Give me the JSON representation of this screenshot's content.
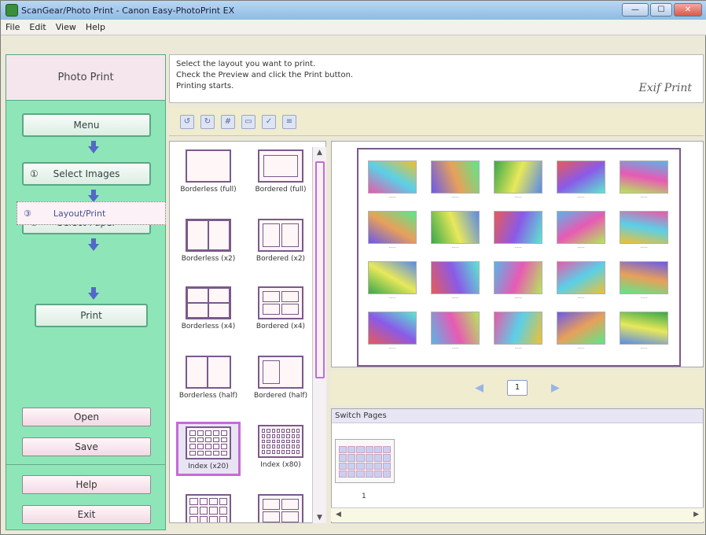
{
  "window": {
    "title": "ScanGear/Photo Print - Canon Easy-PhotoPrint EX",
    "buttons": {
      "minimize": "—",
      "maximize": "☐",
      "close": "✕"
    }
  },
  "menu": {
    "items": [
      "File",
      "Edit",
      "View",
      "Help"
    ]
  },
  "sidebar": {
    "title": "Photo Print",
    "menu_button": "Menu",
    "step1": {
      "num": "①",
      "label": "Select Images"
    },
    "step2": {
      "num": "②",
      "label": "Select Paper"
    },
    "step3": {
      "num": "③",
      "label": "Layout/Print"
    },
    "print_button": "Print",
    "open_button": "Open",
    "save_button": "Save",
    "help_button": "Help",
    "exit_button": "Exit"
  },
  "guide": {
    "line1": "Select the layout you want to print.",
    "line2": "Check the Preview and click the Print button.",
    "line3": "Printing starts.",
    "logo": "Exif Print"
  },
  "layouts": [
    {
      "label": "Borderless (full)"
    },
    {
      "label": "Bordered (full)"
    },
    {
      "label": "Borderless (x2)"
    },
    {
      "label": "Bordered (x2)"
    },
    {
      "label": "Borderless (x4)"
    },
    {
      "label": "Bordered (x4)"
    },
    {
      "label": "Borderless (half)"
    },
    {
      "label": "Bordered (half)"
    },
    {
      "label": "Index (x20)"
    },
    {
      "label": "Index (x80)"
    }
  ],
  "preview": {
    "page": "1"
  },
  "pagestrip": {
    "title": "Switch Pages",
    "page_num": "1"
  },
  "colors": {
    "sidebar": "#8ee6b8",
    "accent": "#c66ad8",
    "toolbar": "#f0ecd0"
  }
}
